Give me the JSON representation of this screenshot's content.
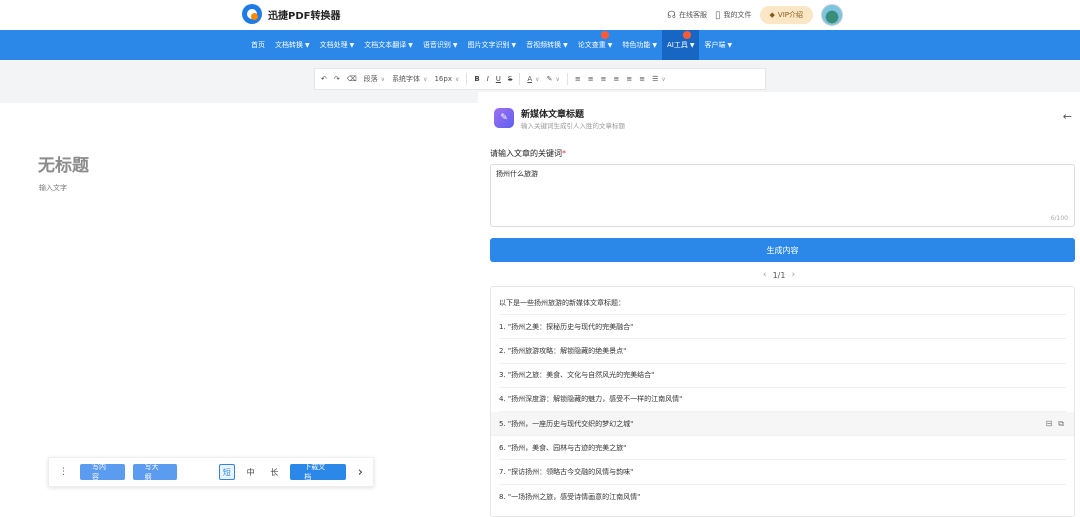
{
  "header": {
    "app_name": "迅捷PDF转换器",
    "online_service": "在线客服",
    "my_files": "我的文件",
    "vip": "VIP介绍"
  },
  "nav": {
    "items": [
      {
        "label": "首页",
        "caret": false
      },
      {
        "label": "文档转换",
        "caret": true
      },
      {
        "label": "文档处理",
        "caret": true
      },
      {
        "label": "文档文本翻译",
        "caret": true
      },
      {
        "label": "语音识别",
        "caret": true
      },
      {
        "label": "图片文字识别",
        "caret": true
      },
      {
        "label": "音视频转换",
        "caret": true
      },
      {
        "label": "论文查重",
        "caret": true
      },
      {
        "label": "特色功能",
        "caret": true
      },
      {
        "label": "AI工具",
        "caret": true
      },
      {
        "label": "客户端",
        "caret": true
      }
    ]
  },
  "toolbar": {
    "paragraph": "段落",
    "font": "系统字体",
    "size": "16px",
    "bold": "B",
    "italic": "I",
    "underline": "U",
    "strike": "S",
    "font_color": "A"
  },
  "editor": {
    "title_placeholder": "无标题",
    "body_placeholder": "输入文字"
  },
  "float_bar": {
    "write_short": "写内容",
    "write_outline": "写大纲",
    "len_short": "短",
    "len_mid": "中",
    "len_long": "长",
    "download": "下载文档"
  },
  "panel": {
    "title": "新媒体文章标题",
    "subtitle": "输入关键词生成引人入胜的文章标题",
    "keyword_label": "请输入文章的关键词",
    "required_mark": "*",
    "keyword_value": "扬州什么旅游",
    "char_count": "6/100",
    "generate": "生成内容",
    "page": "1/1",
    "results": [
      "以下是一些扬州旅游的新媒体文章标题：",
      "1. \"扬州之美：探秘历史与现代的完美融合\"",
      "2. \"扬州旅游攻略：解锁隐藏的绝美景点\"",
      "3. \"扬州之旅：美食、文化与自然风光的完美结合\"",
      "4. \"扬州深度游：解锁隐藏的魅力，感受不一样的江南风情\"",
      "5. \"扬州，一座历史与现代交织的梦幻之城\"",
      "6. \"扬州，美食、园林与古迹的完美之旅\"",
      "7. \"探访扬州：领略古今交融的风情与韵味\"",
      "8. \"一场扬州之旅，感受诗情画意的江南风情\""
    ]
  },
  "colors": {
    "primary": "#2b88e8",
    "nav_active": "#1766c4",
    "required": "#e53935"
  }
}
